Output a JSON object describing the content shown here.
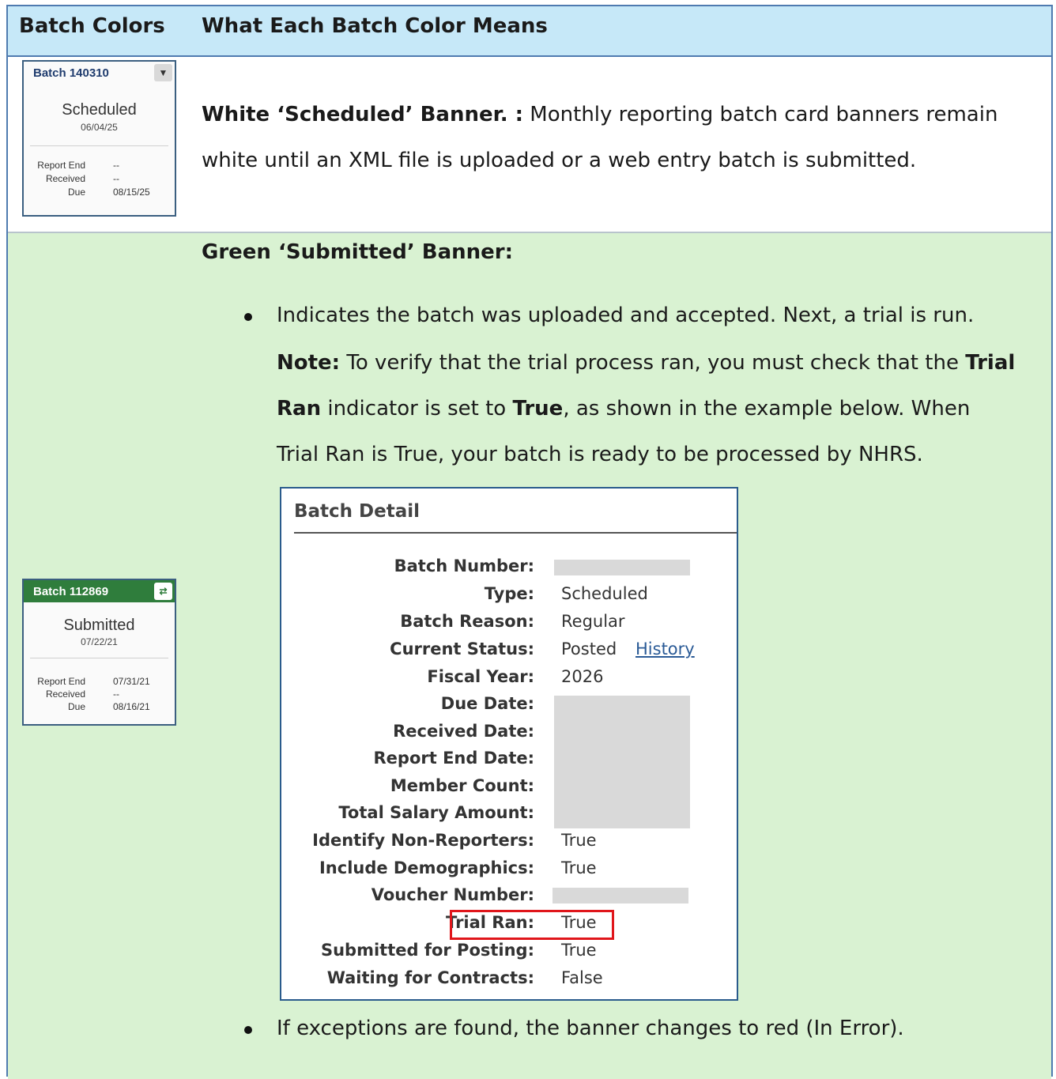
{
  "header": {
    "col1": "Batch Colors",
    "col2": "What Each Batch Color Means"
  },
  "scheduled_card": {
    "title": "Batch 140310",
    "toggle_icon": "chevron-down",
    "status": "Scheduled",
    "status_date": "06/04/25",
    "report_end_label": "Report End",
    "report_end": "--",
    "received_label": "Received",
    "received": "--",
    "due_label": "Due",
    "due": "08/15/25"
  },
  "submitted_card": {
    "title": "Batch 112869",
    "toggle_icon": "swap-arrows",
    "status": "Submitted",
    "status_date": "07/22/21",
    "report_end_label": "Report End",
    "report_end": "07/31/21",
    "received_label": "Received",
    "received": "--",
    "due_label": "Due",
    "due": "08/16/21"
  },
  "white_section": {
    "heading": "White ‘Scheduled’ Banner",
    "heading_suffix": ". :",
    "line1": " Monthly reporting batch card banners remain",
    "line2": "white until an XML file is uploaded or a web entry batch is submitted."
  },
  "green_section": {
    "heading": "Green ‘Submitted’ Banner:",
    "bullet1": "Indicates the batch was uploaded and accepted. Next, a trial is run.",
    "note_label": "Note:",
    "note_text": " To verify that the trial process ran, you must check that the ",
    "note_trial": "Trial",
    "note_ran": "Ran",
    "note_text2": " indicator is set to ",
    "note_true": "True",
    "note_text3": ", as shown in the example below. When",
    "note_line4": "Trial Ran is True, your batch is ready to be processed by NHRS.",
    "bullet2": "If exceptions are found, the banner changes to red (In Error)."
  },
  "batch_detail": {
    "title": "Batch Detail",
    "fields": [
      {
        "label": "Batch Number:",
        "value": ""
      },
      {
        "label": "Type:",
        "value": "Scheduled"
      },
      {
        "label": "Batch Reason:",
        "value": "Regular"
      },
      {
        "label": "Current Status:",
        "value": "Posted"
      },
      {
        "label": "Fiscal Year:",
        "value": "2026"
      },
      {
        "label": "Due Date:",
        "value": ""
      },
      {
        "label": "Received Date:",
        "value": ""
      },
      {
        "label": "Report End Date:",
        "value": ""
      },
      {
        "label": "Member Count:",
        "value": ""
      },
      {
        "label": "Total Salary Amount:",
        "value": ""
      },
      {
        "label": "Identify Non-Reporters:",
        "value": "True"
      },
      {
        "label": "Include Demographics:",
        "value": "True"
      },
      {
        "label": "Voucher Number:",
        "value": ""
      },
      {
        "label": "Trial Ran:",
        "value": "True"
      },
      {
        "label": "Submitted for Posting:",
        "value": "True"
      },
      {
        "label": "Waiting for Contracts:",
        "value": "False"
      }
    ],
    "history_link": "History"
  },
  "colors": {
    "header_bg": "#c6e8f8",
    "green_row_bg": "#d9f2d2",
    "submitted_banner": "#2f7d3c",
    "highlight_box": "#e0161b"
  }
}
